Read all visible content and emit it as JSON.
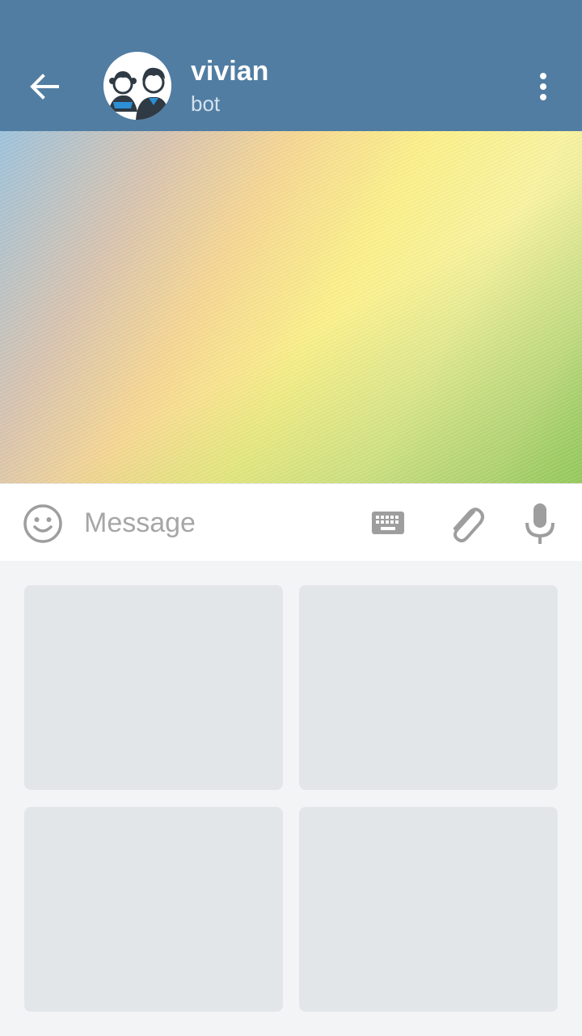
{
  "header": {
    "chat_name": "vivian",
    "status": "bot",
    "background_color": "#517da2",
    "back_icon": "arrow-left-icon",
    "menu_icon": "more-vert-icon",
    "avatar_icon": "two-people-avatar-icon"
  },
  "input_bar": {
    "placeholder": "Message",
    "value": "",
    "emoji_icon": "smiley-icon",
    "keyboard_icon": "keyboard-icon",
    "attach_icon": "paperclip-icon",
    "mic_icon": "microphone-icon"
  },
  "bot_keyboard": {
    "buttons": [
      {
        "label": ""
      },
      {
        "label": ""
      },
      {
        "label": ""
      },
      {
        "label": ""
      }
    ]
  }
}
